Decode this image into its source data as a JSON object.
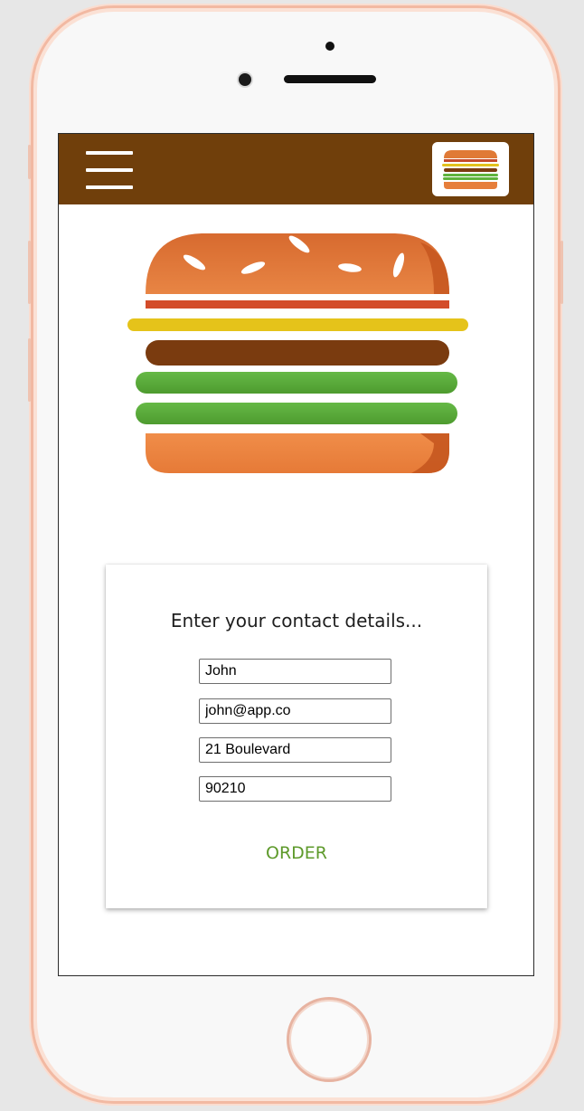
{
  "app": {
    "menu_icon": "hamburger-menu-icon",
    "logo_icon": "burger-logo-icon"
  },
  "hero": {
    "illustration_icon": "burger-illustration"
  },
  "form": {
    "title": "Enter your contact details...",
    "name_value": "John",
    "email_value": "john@app.co",
    "address_value": "21 Boulevard",
    "zip_value": "90210",
    "order_label": "ORDER"
  },
  "colors": {
    "header_bg": "#703f0b",
    "order_text": "#5e9a2b",
    "bun": "#e67e3a",
    "cheese": "#e5c31a",
    "patty": "#7a3b0f",
    "lettuce": "#5fb33d"
  }
}
